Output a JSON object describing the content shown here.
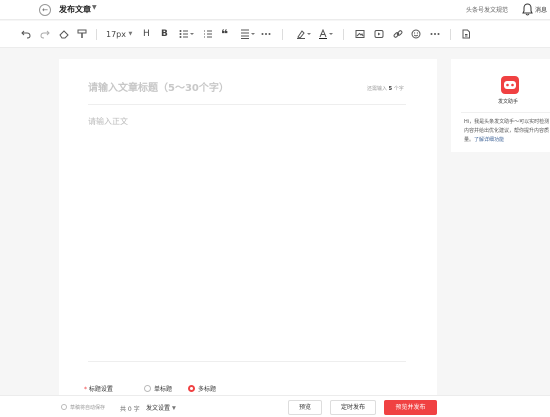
{
  "header": {
    "back_icon": "arrow-left-icon",
    "title": "发布文章",
    "guide_link": "头条号发文规范",
    "messages_label": "消息"
  },
  "toolbar": {
    "font_size": "17px",
    "icons": [
      "undo-icon",
      "redo-icon",
      "eraser-icon",
      "format-painter-icon",
      "heading-icon",
      "bold-icon",
      "unordered-list-icon",
      "ordered-list-icon",
      "quote-icon",
      "align-icon",
      "more-icon",
      "highlight-icon",
      "font-color-icon",
      "image-icon",
      "video-icon",
      "link-icon",
      "emoji-icon",
      "more-icon",
      "draft-icon"
    ]
  },
  "editor": {
    "title_placeholder": "请输入文章标题（5～30个字）",
    "char_hint_prefix": "还需输入",
    "char_hint_count": "5",
    "char_hint_suffix": "个字",
    "body_placeholder": "请输入正文",
    "title_setting_label": "标题设置",
    "single_title_label": "单标题",
    "multi_title_label": "多标题"
  },
  "assistant": {
    "title": "发文助手",
    "text": "Hi，我是头条发文助手～可以实时检测内容并给出优化建议，帮你提升内容质量。",
    "link": "了解详细功能"
  },
  "footer": {
    "autosave": "草稿将自动保存",
    "wordcount": "共 0 字",
    "publish_settings": "发文设置",
    "preview_button": "预览",
    "schedule_button": "定时发布",
    "publish_button": "预览并发布"
  },
  "colors": {
    "accent": "#f04142",
    "link": "#406599"
  }
}
